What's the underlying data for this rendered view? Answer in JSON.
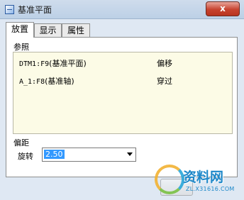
{
  "window": {
    "title": "基准平面",
    "close_glyph": "x"
  },
  "tabs": [
    {
      "label": "放置",
      "active": true
    },
    {
      "label": "显示",
      "active": false
    },
    {
      "label": "属性",
      "active": false
    }
  ],
  "references": {
    "label": "参照",
    "rows": [
      {
        "name": "DTM1:F9",
        "desc": "(基准平面)",
        "type": "偏移"
      },
      {
        "name": "A_1:F8",
        "desc": "(基准轴)",
        "type": "穿过"
      }
    ]
  },
  "offset": {
    "label": "偏距",
    "rotate_label": "旋转",
    "rotate_value": "2.50"
  },
  "watermark": {
    "text": "资料网",
    "url": "ZL.X31616.COM"
  },
  "colors": {
    "list_bg": "#fcfbe6",
    "selection": "#3399ff",
    "close": "#c7432f"
  }
}
